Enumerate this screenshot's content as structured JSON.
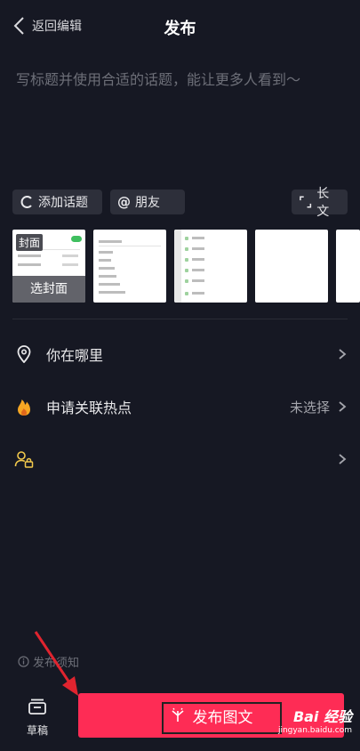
{
  "header": {
    "back_label": "返回编辑",
    "title": "发布"
  },
  "caption": {
    "placeholder": "写标题并使用合适的话题，能让更多人看到～"
  },
  "chips": {
    "topic": "添加话题",
    "friend_at": "@",
    "friend": "朋友",
    "long_text": "长文"
  },
  "cover": {
    "tag": "封面",
    "select_label": "选封面"
  },
  "rows": {
    "location": {
      "label": "你在哪里"
    },
    "hotspot": {
      "label": "申请关联热点",
      "value": "未选择"
    },
    "permission": {
      "label": ""
    }
  },
  "footer": {
    "notice": "发布须知",
    "draft": "草稿",
    "publish": "发布图文"
  },
  "watermark": {
    "brand": "Bai 经验",
    "url": "jingyan.baidu.com"
  },
  "colors": {
    "background": "#161823",
    "accent": "#fe2c55",
    "chip": "#2d2f3a",
    "hot_icon": "#f5a623",
    "permission_icon": "#f2c94c"
  }
}
